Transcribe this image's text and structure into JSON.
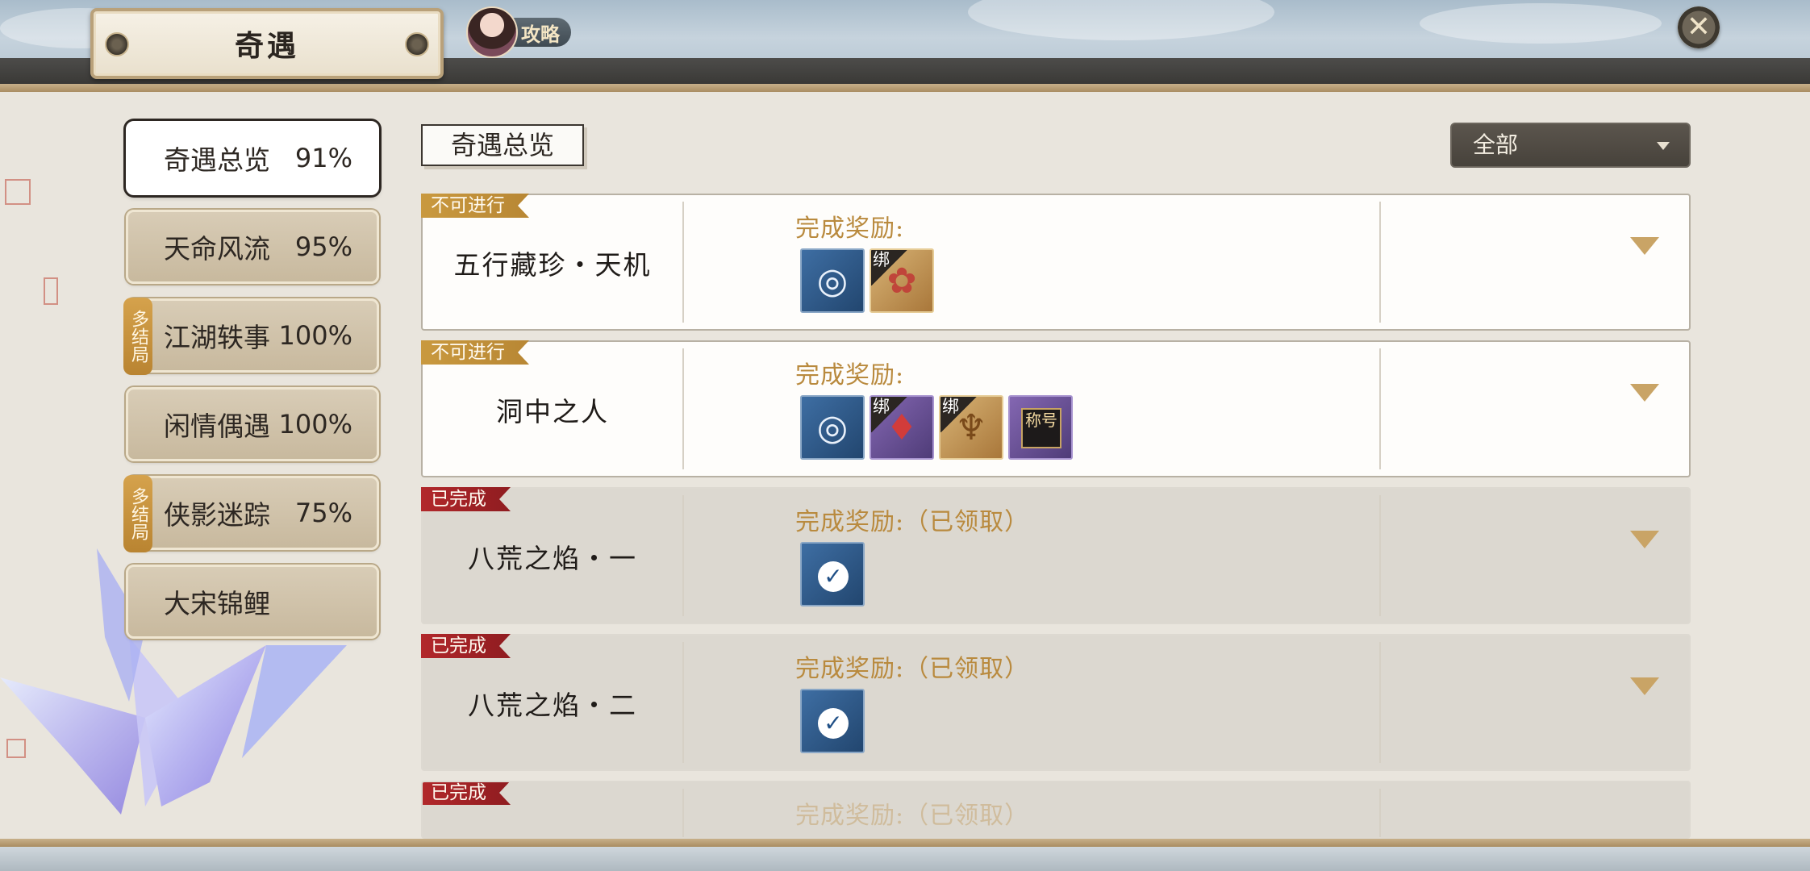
{
  "header": {
    "title": "奇遇",
    "guide_label": "攻略",
    "close_icon": "close-x-icon"
  },
  "tabs": [
    {
      "label": "奇遇总览",
      "percent": "91%",
      "active": true,
      "multi_ending": false
    },
    {
      "label": "天命风流",
      "percent": "95%",
      "active": false,
      "multi_ending": false
    },
    {
      "label": "江湖轶事",
      "percent": "100%",
      "active": false,
      "multi_ending": true
    },
    {
      "label": "闲情偶遇",
      "percent": "100%",
      "active": false,
      "multi_ending": false
    },
    {
      "label": "侠影迷踪",
      "percent": "75%",
      "active": false,
      "multi_ending": true
    },
    {
      "label": "大宋锦鲤",
      "percent": "",
      "active": false,
      "multi_ending": false
    }
  ],
  "multi_ending_badge": "多结局",
  "section_title": "奇遇总览",
  "filter": {
    "selected": "全部",
    "icon": "chevron-down-icon"
  },
  "quests": [
    {
      "status": "不可进行",
      "status_type": "locked",
      "name": "五行藏珍・天机",
      "reward_label": "完成奖励:",
      "items": [
        {
          "icon": "silver-medallion-icon",
          "rarity": "blue",
          "bound": false
        },
        {
          "icon": "flower-accessory-icon",
          "rarity": "gold",
          "bound": true
        }
      ]
    },
    {
      "status": "不可进行",
      "status_type": "locked",
      "name": "洞中之人",
      "reward_label": "完成奖励:",
      "items": [
        {
          "icon": "silver-medallion-icon",
          "rarity": "blue",
          "bound": false
        },
        {
          "icon": "red-pouch-icon",
          "rarity": "purple",
          "bound": true
        },
        {
          "icon": "tassel-pendant-icon",
          "rarity": "gold",
          "bound": true
        },
        {
          "icon": "title-badge-icon",
          "rarity": "purple",
          "bound": false,
          "badge_text": "称号"
        }
      ]
    },
    {
      "status": "已完成",
      "status_type": "completed",
      "name": "八荒之焰・一",
      "reward_label": "完成奖励:（已领取）",
      "items": [
        {
          "icon": "claimed-check-icon",
          "rarity": "blue",
          "bound": false
        }
      ]
    },
    {
      "status": "已完成",
      "status_type": "completed",
      "name": "八荒之焰・二",
      "reward_label": "完成奖励:（已领取）",
      "items": [
        {
          "icon": "claimed-check-icon",
          "rarity": "blue",
          "bound": false
        }
      ]
    },
    {
      "status": "已完成",
      "status_type": "completed",
      "name": "",
      "reward_label": "完成奖励:（已领取）",
      "items": []
    }
  ],
  "bind_label": "绑",
  "colors": {
    "reward_gold": "#b98a3e",
    "locked_ribbon": "#c9993f",
    "completed_ribbon": "#b2282b",
    "filter_bg": "#4f4a43"
  }
}
